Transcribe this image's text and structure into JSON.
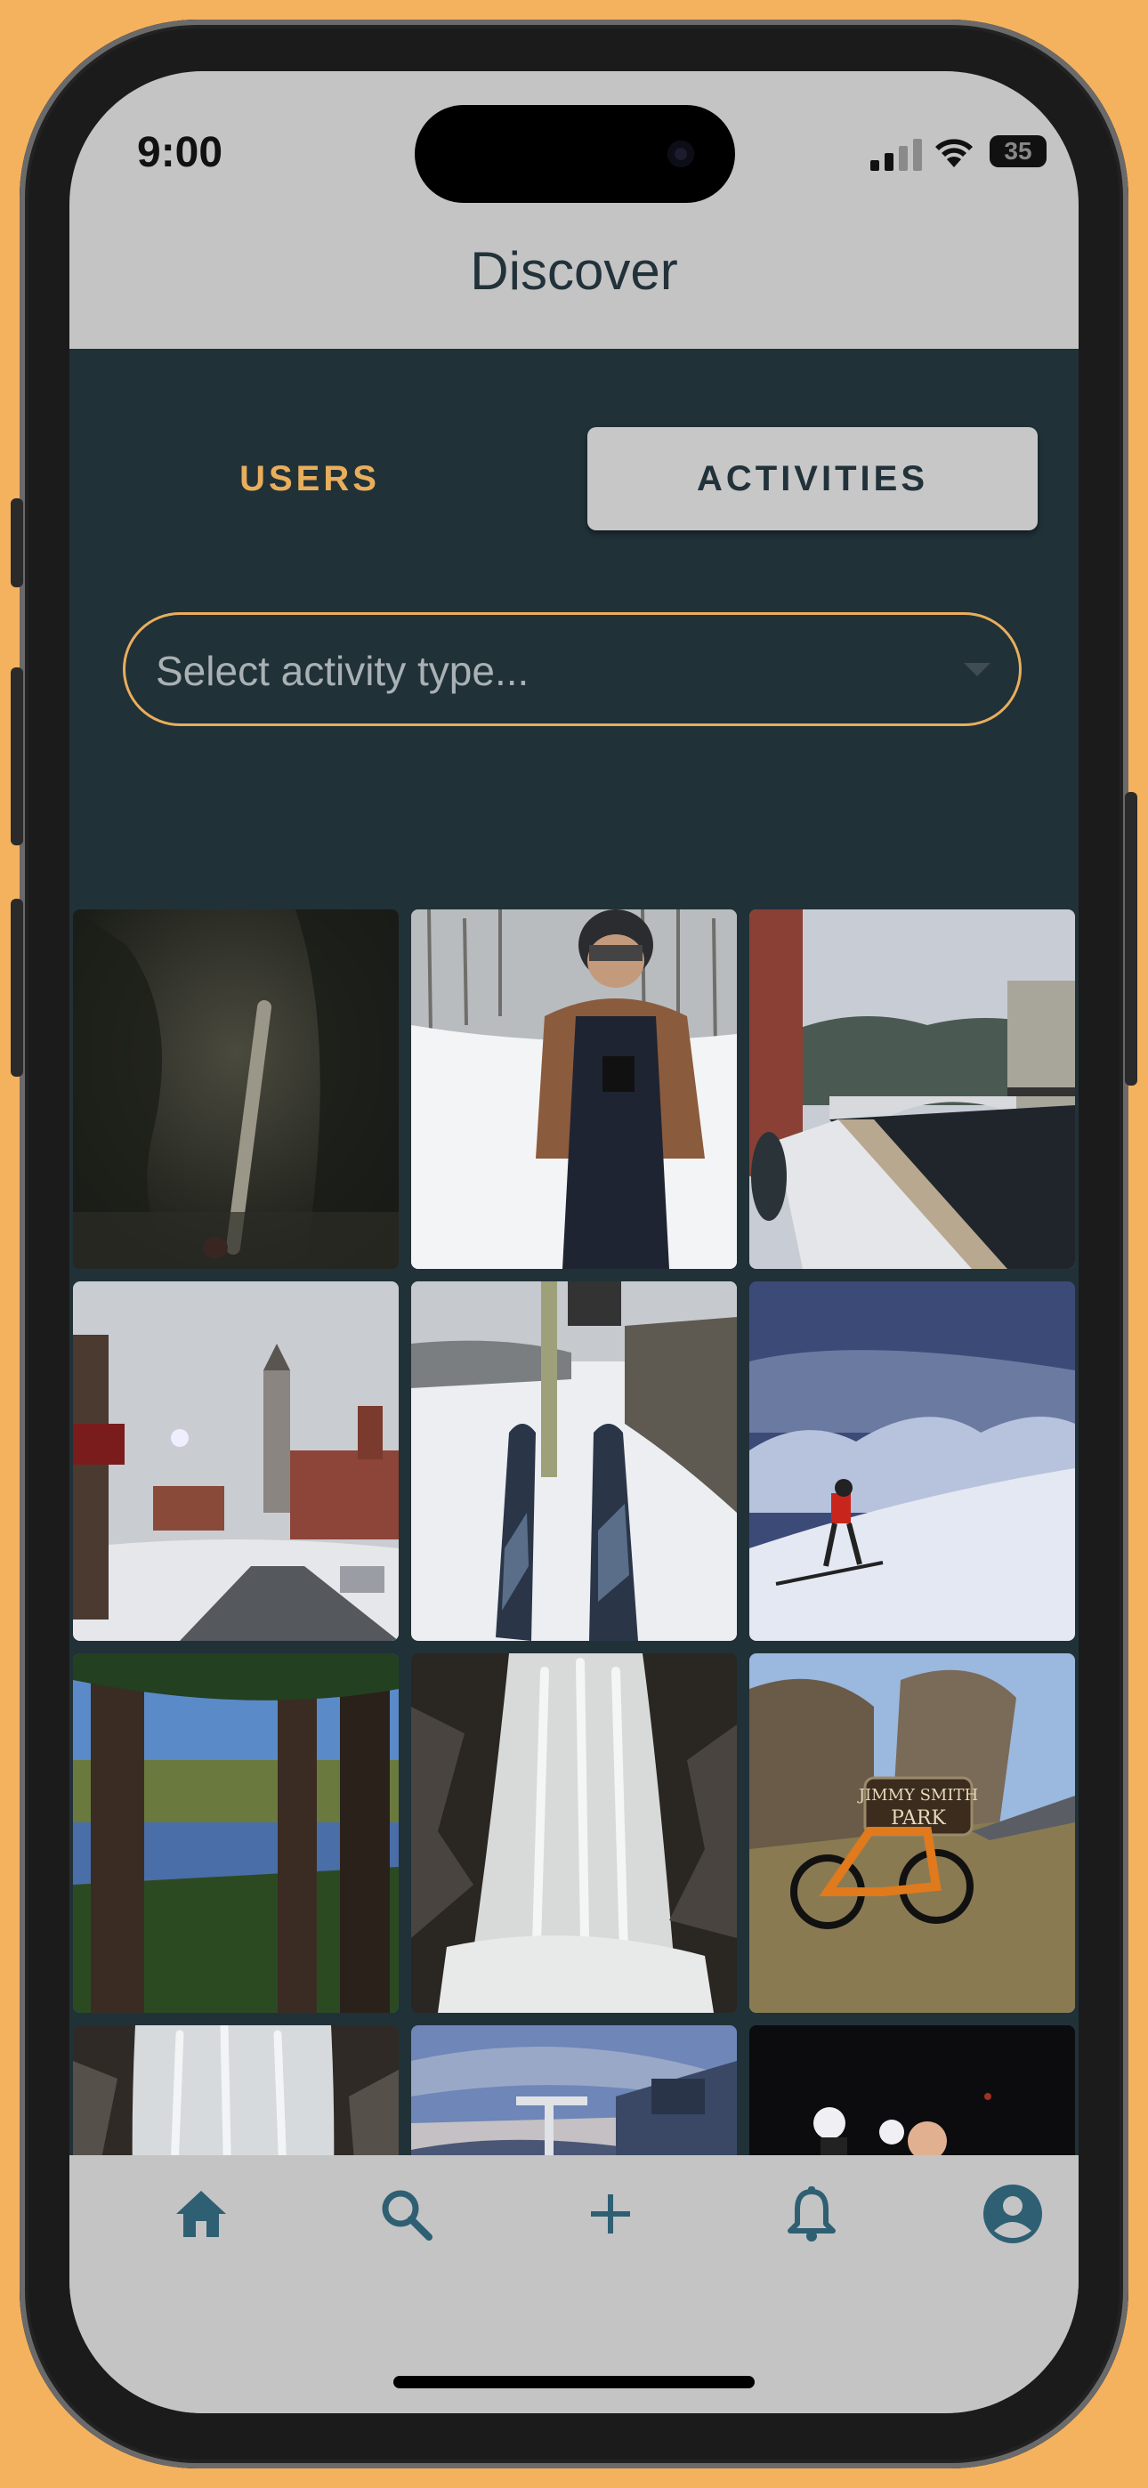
{
  "status_bar": {
    "time": "9:00",
    "battery": "35"
  },
  "header": {
    "title": "Discover"
  },
  "tabs": {
    "users": "USERS",
    "activities": "ACTIVITIES",
    "selected": "ACTIVITIES"
  },
  "filter": {
    "placeholder": "Select activity type..."
  },
  "photos": [
    "dark icy cave with ice axe",
    "man in winter gear on ski slope",
    "snowy river bridge in town",
    "snowy town street with clock tower",
    "skis on chairlift above snowy trail",
    "skier skinning up snowy ridge",
    "forest lake with blue sky",
    "frozen waterfall",
    "orange bike at Jimmy Smith Park sign",
    "frozen icefall",
    "ski lift tower at dawn",
    "hikers with headlamps at night"
  ],
  "photo_signs": {
    "park_sign_line1": "JIMMY SMITH",
    "park_sign_line2": "PARK"
  },
  "bottom_nav": [
    "home-icon",
    "search-icon",
    "add-icon",
    "bell-icon",
    "account-icon"
  ],
  "colors": {
    "accent": "#E9AE5C",
    "panel": "#213138",
    "background": "#F4B25F",
    "chrome": "#C4C4C4",
    "nav_icon": "#2F5F73"
  }
}
